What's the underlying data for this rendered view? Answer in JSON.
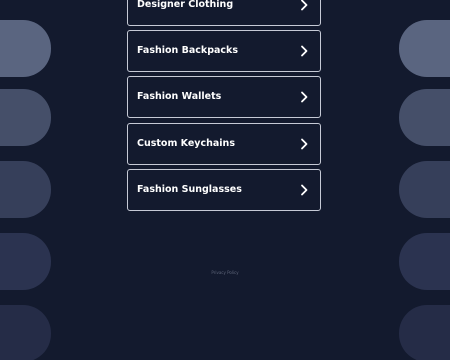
{
  "links": [
    {
      "label": "Designer Clothing"
    },
    {
      "label": "Fashion Backpacks"
    },
    {
      "label": "Fashion Wallets"
    },
    {
      "label": "Custom Keychains"
    },
    {
      "label": "Fashion Sunglasses"
    }
  ],
  "footer": {
    "privacy_label": "Privacy Policy"
  },
  "colors": {
    "background": "#131a2e",
    "link_border": "#c6cad6",
    "link_text": "#ffffff"
  },
  "icons": {
    "link_arrow": "chevron-right-icon"
  }
}
